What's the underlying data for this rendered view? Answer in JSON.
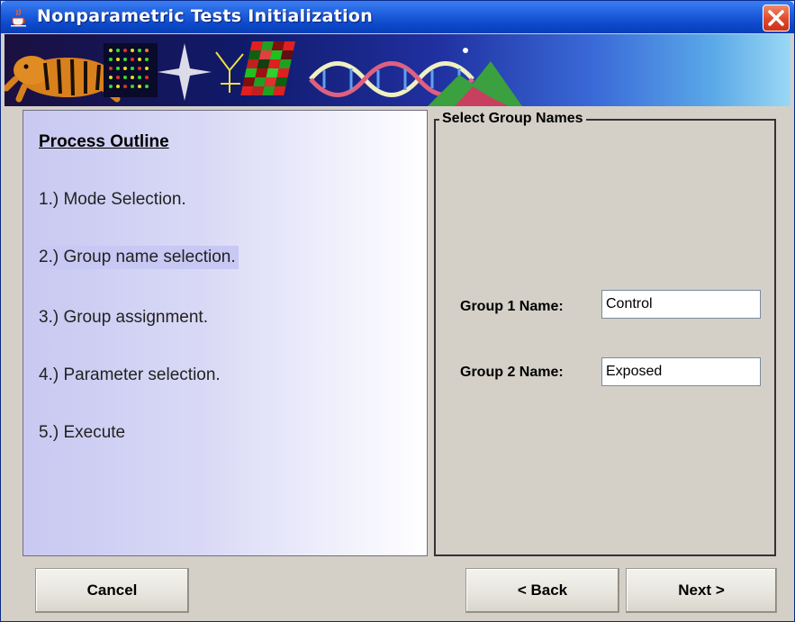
{
  "window": {
    "title": "Nonparametric Tests Initialization"
  },
  "outline": {
    "title": "Process Outline",
    "steps": [
      {
        "label": "1.) Mode Selection."
      },
      {
        "label": "2.) Group name selection."
      },
      {
        "label": "3.) Group assignment."
      },
      {
        "label": "4.) Parameter selection."
      },
      {
        "label": "5.) Execute"
      }
    ],
    "active_step": 2
  },
  "group_names": {
    "title": "Select Group Names",
    "group1_label": "Group 1 Name:",
    "group1_value": "Control",
    "group2_label": "Group 2 Name:",
    "group2_value": "Exposed"
  },
  "buttons": {
    "cancel": "Cancel",
    "back": "< Back",
    "next": "Next >"
  },
  "colors": {
    "titlebar": "#0b47c8",
    "close": "#e0482a",
    "active_step_bg": "#c8c8f4"
  }
}
